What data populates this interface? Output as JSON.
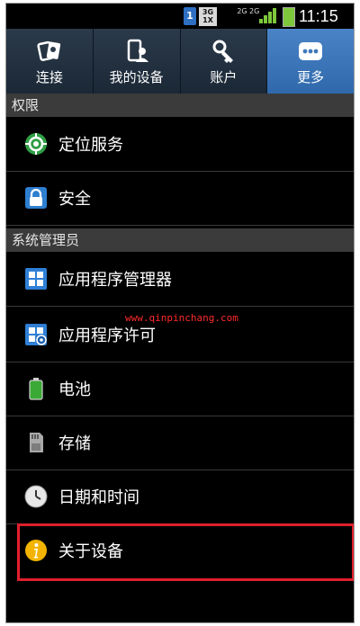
{
  "status_bar": {
    "sim": "1",
    "net_top": "3G",
    "net_bottom": "1X",
    "net2_top": "2G",
    "net2_bottom": "2G",
    "time": "11:15"
  },
  "tabs": [
    {
      "label": "连接",
      "icon": "connections-icon"
    },
    {
      "label": "我的设备",
      "icon": "my-device-icon"
    },
    {
      "label": "账户",
      "icon": "accounts-icon"
    },
    {
      "label": "更多",
      "icon": "more-icon",
      "active": true
    }
  ],
  "sections": {
    "permissions": "权限",
    "admin": "系统管理员"
  },
  "items": [
    {
      "label": "定位服务",
      "icon": "location-icon"
    },
    {
      "label": "安全",
      "icon": "lock-icon"
    },
    {
      "label": "应用程序管理器",
      "icon": "app-manager-icon"
    },
    {
      "label": "应用程序许可",
      "icon": "app-permission-icon"
    },
    {
      "label": "电池",
      "icon": "battery-icon"
    },
    {
      "label": "存储",
      "icon": "storage-icon"
    },
    {
      "label": "日期和时间",
      "icon": "clock-icon"
    },
    {
      "label": "关于设备",
      "icon": "info-icon"
    }
  ],
  "watermark": "www.qinpinchang.com",
  "colors": {
    "tab_active": "#3f79bc",
    "highlight": "#e0202c",
    "section_bg": "#3b3b3b"
  }
}
